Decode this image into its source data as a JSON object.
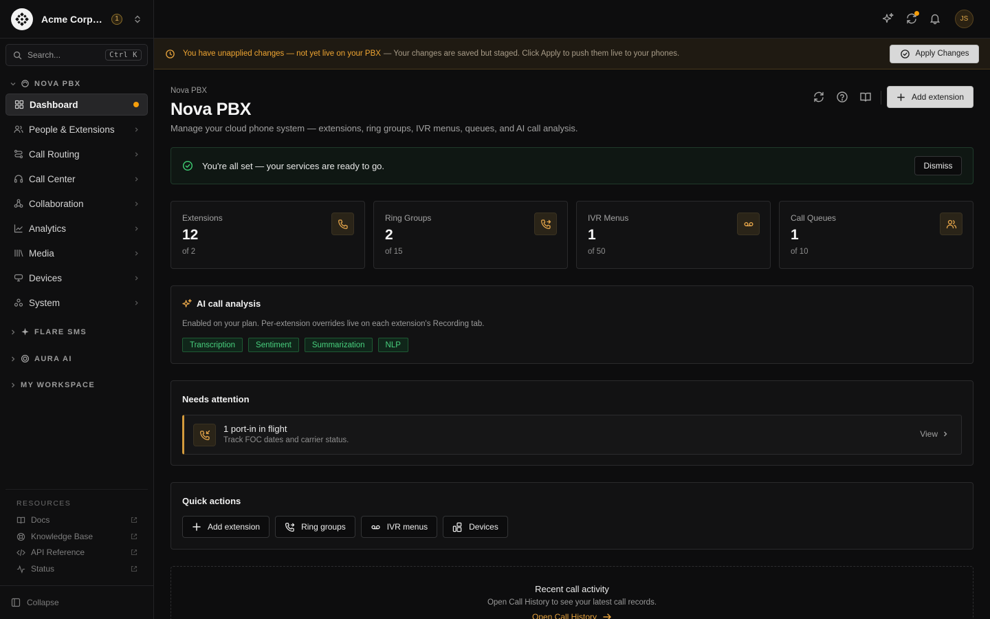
{
  "org": {
    "name": "Acme Corporation",
    "badge": "1"
  },
  "search": {
    "placeholder": "Search...",
    "shortcut": "Ctrl K"
  },
  "sidebar": {
    "section": "NOVA PBX",
    "items": [
      {
        "label": "Dashboard",
        "icon": "dashboard-icon",
        "active": true
      },
      {
        "label": "People & Extensions",
        "icon": "people-icon"
      },
      {
        "label": "Call Routing",
        "icon": "routing-icon"
      },
      {
        "label": "Call Center",
        "icon": "headset-icon"
      },
      {
        "label": "Collaboration",
        "icon": "collaboration-icon"
      },
      {
        "label": "Analytics",
        "icon": "analytics-icon"
      },
      {
        "label": "Media",
        "icon": "media-icon"
      },
      {
        "label": "Devices",
        "icon": "devices-icon"
      },
      {
        "label": "System",
        "icon": "system-icon"
      }
    ],
    "other_sections": [
      "FLARE SMS",
      "AURA AI",
      "MY WORKSPACE"
    ],
    "resources_title": "RESOURCES",
    "resources": [
      "Docs",
      "Knowledge Base",
      "API Reference",
      "Status"
    ],
    "collapse": "Collapse"
  },
  "topbar": {
    "avatar": "JS"
  },
  "banner": {
    "strong": "You have unapplied changes — not yet live on your PBX",
    "rest": "— Your changes are saved but staged. Click Apply to push them live to your phones.",
    "button": "Apply Changes"
  },
  "page": {
    "breadcrumb": "Nova PBX",
    "title": "Nova PBX",
    "subtitle": "Manage your cloud phone system — extensions, ring groups, IVR menus, queues, and AI call analysis.",
    "add_button": "Add extension"
  },
  "ready": {
    "text": "You're all set — your services are ready to go.",
    "dismiss": "Dismiss"
  },
  "stats": [
    {
      "label": "Extensions",
      "value": "12",
      "of": "of 2",
      "icon": "phone-icon"
    },
    {
      "label": "Ring Groups",
      "value": "2",
      "of": "of 15",
      "icon": "phone-forward-icon"
    },
    {
      "label": "IVR Menus",
      "value": "1",
      "of": "of 50",
      "icon": "voicemail-icon"
    },
    {
      "label": "Call Queues",
      "value": "1",
      "of": "of 10",
      "icon": "users-icon"
    }
  ],
  "ai": {
    "title": "AI call analysis",
    "description": "Enabled on your plan. Per-extension overrides live on each extension's Recording tab.",
    "chips": [
      "Transcription",
      "Sentiment",
      "Summarization",
      "NLP"
    ]
  },
  "attention": {
    "title": "Needs attention",
    "item_title": "1 port-in in flight",
    "item_sub": "Track FOC dates and carrier status.",
    "view": "View"
  },
  "quick_actions": {
    "title": "Quick actions",
    "buttons": [
      "Add extension",
      "Ring groups",
      "IVR menus",
      "Devices"
    ]
  },
  "recent": {
    "title": "Recent call activity",
    "subtitle": "Open Call History to see your latest call records.",
    "link": "Open Call History"
  },
  "colors": {
    "accent": "#f59e0b",
    "success": "#3ecf74",
    "background": "#0d0d0e"
  }
}
